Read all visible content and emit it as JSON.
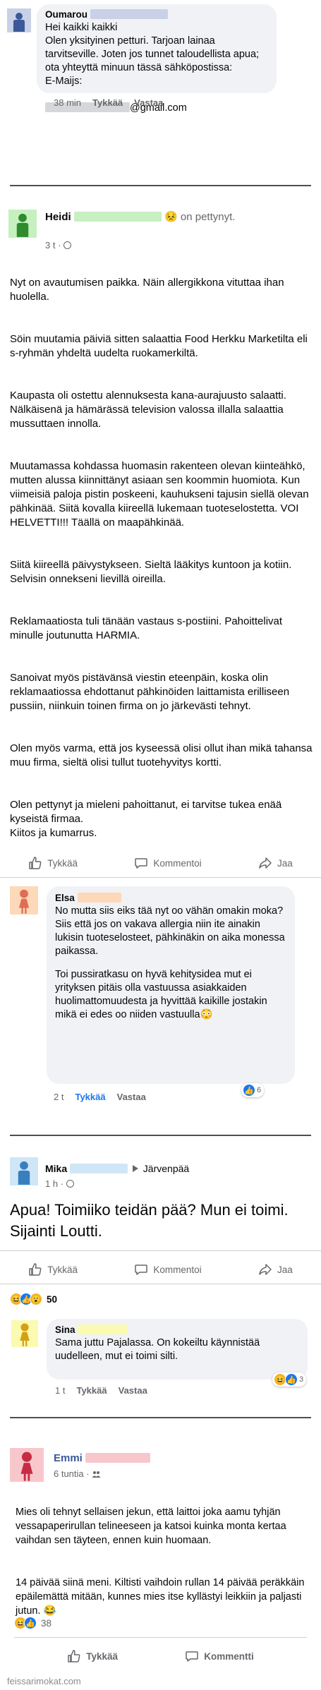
{
  "colors": {
    "accent": "#1877f2",
    "bubble": "#f0f2f5",
    "censor_gray": "#c9d1e6",
    "censor_green": "#c6f0bf",
    "censor_peach": "#fdd9b9",
    "censor_blue": "#cfe6f7",
    "censor_yellow": "#fafab0",
    "censor_pink": "#f8c7cc"
  },
  "comment1": {
    "author": "Oumarou",
    "text": "Hei kaikki kaikki\nOlen yksityinen petturi. Tarjoan lainaa tarvitseville. Joten jos tunnet taloudellista apua; ota yhteyttä minuun tässä sähköpostissa:\nE-Maijs:",
    "email_suffix": "@gmail.com",
    "time": "38 min",
    "like_label": "Tykkää",
    "reply_label": "Vastaa"
  },
  "post1": {
    "author": "Heidi",
    "feeling_emoji": "😣",
    "feeling_text": "on pettynyt.",
    "time": "3 t",
    "privacy_icon": "globe-icon",
    "paragraphs": [
      "Nyt on avautumisen paikka. Näin allergikkona vituttaa ihan huolella.",
      "Söin muutamia päiviä sitten salaattia Food Herkku Marketilta eli s-ryhmän yhdeltä uudelta ruokamerkiltä.",
      "Kaupasta oli ostettu alennuksesta kana-aurajuusto salaatti. Nälkäisenä ja hämärässä television valossa illalla salaattia mussuttaen innolla.",
      "Muutamassa kohdassa huomasin rakenteen olevan kiinteähkö, mutten alussa kiinnittänyt asiaan sen koommin huomiota. Kun viimeisiä paloja pistin poskeeni, kauhukseni tajusin siellä olevan pähkinää. Siitä kovalla kiireellä lukemaan tuoteselostetta. VOI HELVETTI!!! Täällä on maapähkinää.",
      "Siitä kiireellä päivystykseen. Sieltä lääkitys kuntoon ja kotiin. Selvisin onnekseni lievillä oireilla.",
      "Reklamaatiosta tuli tänään vastaus s-postiini. Pahoittelivat minulle joutunutta HARMIA.",
      "Sanoivat myös pistävänsä viestin eteenpäin, koska olin reklamaatiossa ehdottanut pähkinöiden laittamista erilliseen pussiin, niinkuin toinen firma on jo järkevästi tehnyt.",
      "Olen myös varma, että jos kyseessä olisi ollut ihan mikä tahansa muu firma, sieltä olisi tullut tuotehyvitys kortti.",
      "Olen pettynyt ja mieleni pahoittanut, ei tarvitse tukea enää kyseistä firmaa.\nKiitos ja kumarrus."
    ],
    "actions": {
      "like": "Tykkää",
      "comment": "Kommentoi",
      "share": "Jaa"
    }
  },
  "comment2": {
    "author": "Elsa",
    "text_a": "No mutta siis eiks tää nyt oo vähän omakin moka? Siis että jos on vakava allergia niin ite ainakin lukisin tuoteselosteet, pähkinäkin on aika monessa paikassa.",
    "text_b": "Toi pussiratkasu on hyvä kehitysidea mut ei yrityksen pitäis olla vastuussa asiakkaiden huolimattomuudesta ja hyvittää kaikille jostakin mikä ei edes oo niiden vastuulla",
    "text_b_emoji": "😳",
    "time": "2 t",
    "like_label": "Tykkää",
    "reply_label": "Vastaa",
    "reaction_count": "6"
  },
  "post2": {
    "author": "Mika",
    "arrow_icon": "triangle-right-icon",
    "destination": "Järvenpää",
    "time": "1 h",
    "privacy_icon": "globe-icon",
    "text": "Apua! Toimiiko teidän pää? Mun ei toimi. Sijainti Loutti.",
    "actions": {
      "like": "Tykkää",
      "comment": "Kommentoi",
      "share": "Jaa"
    },
    "reaction_count": "50"
  },
  "comment3": {
    "author": "Sina",
    "text": "Sama juttu Pajalassa. On kokeiltu käynnistää uudelleen, mut ei toimi silti.",
    "time": "1 t",
    "like_label": "Tykkää",
    "reply_label": "Vastaa",
    "reaction_count": "3"
  },
  "post3": {
    "author": "Emmi",
    "time": "6 tuntia",
    "privacy_icon": "friends-icon",
    "paragraphs": [
      "Mies oli tehnyt sellaisen jekun, että laittoi joka aamu tyhjän vessapaperirullan telineeseen ja katsoi kuinka monta kertaa vaihdan sen täyteen, ennen kuin huomaan.",
      "14 päivää siinä meni. Kiltisti vaihdoin rullan 14 päivää peräkkäin epäilemättä mitään, kunnes mies itse kyllästyi leikkiin ja paljasti jutun. 😂"
    ],
    "reaction_count": "38",
    "actions": {
      "like": "Tykkää",
      "comment": "Kommentti"
    }
  },
  "watermark": "feissarimokat.com"
}
